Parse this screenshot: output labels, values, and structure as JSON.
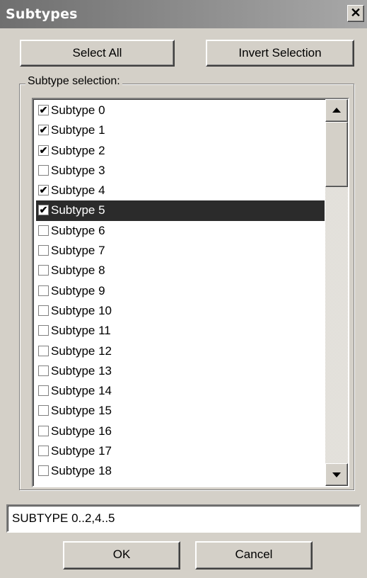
{
  "window": {
    "title": "Subtypes",
    "close_glyph": "✕"
  },
  "buttons": {
    "select_all": "Select All",
    "invert_selection": "Invert Selection",
    "ok": "OK",
    "cancel": "Cancel"
  },
  "group": {
    "label": "Subtype selection:"
  },
  "list": {
    "items": [
      {
        "label": "Subtype 0",
        "checked": true,
        "selected": false
      },
      {
        "label": "Subtype 1",
        "checked": true,
        "selected": false
      },
      {
        "label": "Subtype 2",
        "checked": true,
        "selected": false
      },
      {
        "label": "Subtype 3",
        "checked": false,
        "selected": false
      },
      {
        "label": "Subtype 4",
        "checked": true,
        "selected": false
      },
      {
        "label": "Subtype 5",
        "checked": true,
        "selected": true
      },
      {
        "label": "Subtype 6",
        "checked": false,
        "selected": false
      },
      {
        "label": "Subtype 7",
        "checked": false,
        "selected": false
      },
      {
        "label": "Subtype 8",
        "checked": false,
        "selected": false
      },
      {
        "label": "Subtype 9",
        "checked": false,
        "selected": false
      },
      {
        "label": "Subtype 10",
        "checked": false,
        "selected": false
      },
      {
        "label": "Subtype 11",
        "checked": false,
        "selected": false
      },
      {
        "label": "Subtype 12",
        "checked": false,
        "selected": false
      },
      {
        "label": "Subtype 13",
        "checked": false,
        "selected": false
      },
      {
        "label": "Subtype 14",
        "checked": false,
        "selected": false
      },
      {
        "label": "Subtype 15",
        "checked": false,
        "selected": false
      },
      {
        "label": "Subtype 16",
        "checked": false,
        "selected": false
      },
      {
        "label": "Subtype 17",
        "checked": false,
        "selected": false
      },
      {
        "label": "Subtype 18",
        "checked": false,
        "selected": false
      }
    ]
  },
  "summary_field": {
    "value": "SUBTYPE 0..2,4..5"
  },
  "icons": {
    "check": "check-icon",
    "scroll_up": "arrow-up-icon",
    "scroll_down": "arrow-down-icon",
    "close": "close-icon"
  },
  "colors": {
    "face": "#d4d0c8",
    "selection": "#2b2b2b"
  }
}
